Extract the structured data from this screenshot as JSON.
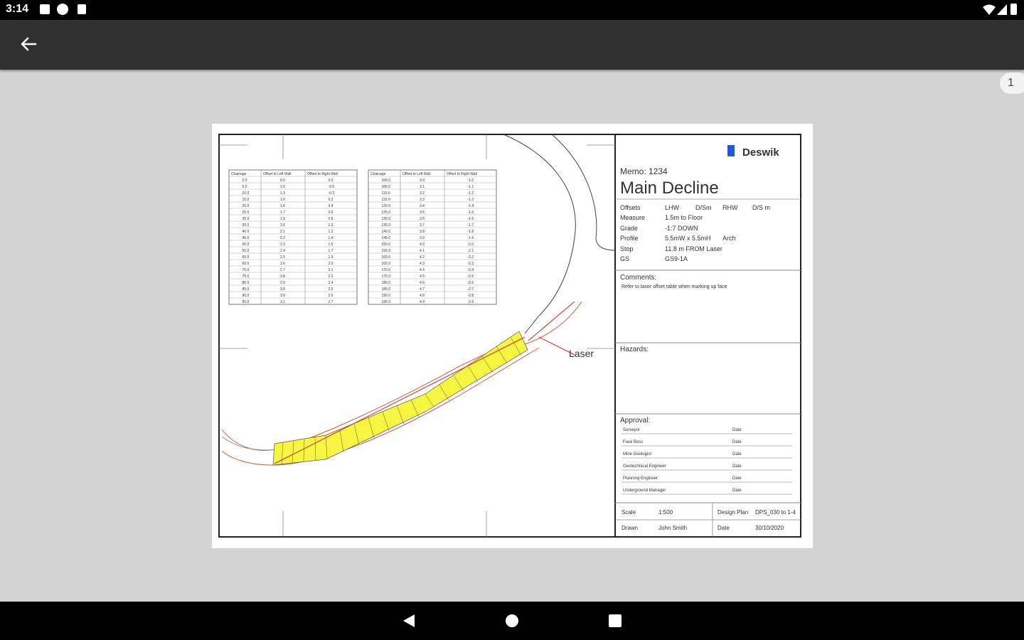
{
  "status_bar": {
    "time": "3:14"
  },
  "app_bar": {
    "back_icon": "arrow-left-icon"
  },
  "page_indicator": "1",
  "drawing": {
    "title_block": {
      "logo_text": "Deswik",
      "memo": "Memo: 1234",
      "title": "Main Decline",
      "offsets_label": "Offsets",
      "offsets_values": [
        "LHW",
        "D/Sm",
        "RHW",
        "D/S m"
      ],
      "measure_label": "Measure",
      "measure_value": "1.5m to Floor",
      "grade_label": "Grade",
      "grade_value": "-1:7 DOWN",
      "profile_label": "Profile",
      "profile_value": "5.5mW x 5.5mH",
      "profile_type": "Arch",
      "stop_label": "Stop",
      "stop_value": "11.8 m FROM  Laser",
      "gs_label": "GS",
      "gs_value": "GS9-1A",
      "comments_label": "Comments:",
      "comments_text": "Refer to laser offset table when marking up face",
      "hazards_label": "Hazards:",
      "approval_label": "Approval:",
      "approvers": [
        "Surveyor",
        "Face Boss",
        "Mine Geologist",
        "Geotechnical Engineer",
        "Planning Engineer",
        "Underground Manager"
      ],
      "date_label": "Date",
      "scale_label": "Scale",
      "scale_value": "1:500",
      "design_plan_label": "Design Plan",
      "design_plan_value": "DPS_030 to 1-4",
      "drawn_label": "Drawn",
      "drawn_value": "John Smith",
      "date_value": "30/10/2020"
    },
    "laser_label": "Laser",
    "table_headers": [
      "Chainage",
      "Offset to Left Wall",
      "Offset to Right Wall"
    ],
    "table_left": [
      [
        "0.0",
        "0.0",
        "0.0"
      ],
      [
        "5.0",
        "1.0",
        "-0.5"
      ],
      [
        "10.0",
        "1.3",
        "-0.3"
      ],
      [
        "15.0",
        "1.6",
        "0.2"
      ],
      [
        "20.0",
        "1.8",
        "0.4"
      ],
      [
        "25.0",
        "1.7",
        "0.6"
      ],
      [
        "30.0",
        "1.9",
        "0.8"
      ],
      [
        "35.0",
        "2.0",
        "1.0"
      ],
      [
        "40.0",
        "2.1",
        "1.2"
      ],
      [
        "45.0",
        "2.2",
        "1.4"
      ],
      [
        "50.0",
        "2.3",
        "1.5"
      ],
      [
        "55.0",
        "2.4",
        "1.7"
      ],
      [
        "60.0",
        "2.5",
        "1.9"
      ],
      [
        "65.0",
        "2.6",
        "2.0"
      ],
      [
        "70.0",
        "2.7",
        "2.1"
      ],
      [
        "75.0",
        "2.8",
        "2.2"
      ],
      [
        "80.0",
        "2.9",
        "2.4"
      ],
      [
        "85.0",
        "3.0",
        "2.5"
      ],
      [
        "90.0",
        "3.0",
        "2.6"
      ],
      [
        "95.0",
        "3.1",
        "2.7"
      ]
    ],
    "table_right": [
      [
        "100.0",
        "3.0",
        "-1.0"
      ],
      [
        "105.0",
        "3.1",
        "-1.1"
      ],
      [
        "110.0",
        "3.2",
        "-1.2"
      ],
      [
        "115.0",
        "3.3",
        "-1.3"
      ],
      [
        "120.0",
        "3.4",
        "-1.4"
      ],
      [
        "125.0",
        "3.5",
        "-1.5"
      ],
      [
        "130.0",
        "3.6",
        "-1.6"
      ],
      [
        "135.0",
        "3.7",
        "-1.7"
      ],
      [
        "140.0",
        "3.8",
        "-1.8"
      ],
      [
        "145.0",
        "3.9",
        "-1.9"
      ],
      [
        "150.0",
        "4.0",
        "-2.0"
      ],
      [
        "155.0",
        "4.1",
        "-2.1"
      ],
      [
        "160.0",
        "4.2",
        "-2.2"
      ],
      [
        "165.0",
        "4.3",
        "-2.3"
      ],
      [
        "170.0",
        "4.4",
        "-2.4"
      ],
      [
        "175.0",
        "4.5",
        "-2.5"
      ],
      [
        "180.0",
        "4.6",
        "-2.6"
      ],
      [
        "185.0",
        "4.7",
        "-2.7"
      ],
      [
        "190.0",
        "4.8",
        "-2.8"
      ],
      [
        "195.0",
        "4.9",
        "-2.9"
      ]
    ],
    "colors": {
      "drive_fill": "#f5f542",
      "laser_red": "#e02020",
      "logo_blue": "#1a5ad8"
    }
  },
  "nav_bar": {
    "back_icon": "nav-back-icon",
    "home_icon": "nav-home-icon",
    "recents_icon": "nav-recents-icon"
  }
}
